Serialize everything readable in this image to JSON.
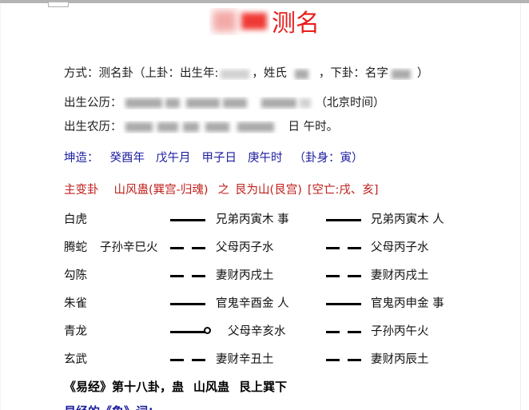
{
  "document": {
    "title_visible_text": "测名",
    "title_color": "#ea1c1c",
    "title_redacted_chars": 2
  },
  "info": {
    "method_label": "方式：",
    "method_value_a": "测名卦（上卦：出生年:",
    "method_value_b": "，姓氏",
    "method_value_c": "，下卦：名字",
    "method_value_d": "）",
    "solar_label": "出生公历：",
    "solar_suffix": "（北京时间）",
    "lunar_label": "出生农历：",
    "lunar_mid": "日",
    "lunar_suffix": "午时。"
  },
  "pillars": {
    "color": "#1c1ca0",
    "gender_label": "坤造：",
    "year": "癸酉年",
    "month": "戊午月",
    "day": "甲子日",
    "hour": "庚午时",
    "guashen": "（卦身：寅）"
  },
  "gua": {
    "color": "#c0201c",
    "label": "主变卦",
    "primary": "山风蛊(巽宫-归魂)",
    "connector": "之",
    "changed": "艮为山(艮宫)",
    "kongwang": "[空亡:戌、亥]"
  },
  "hexagram_rows": [
    {
      "beast": "白虎",
      "fushen": "",
      "yao_left": "solid",
      "yao_left_marker": false,
      "text_left": "兄弟丙寅木 事",
      "yao_right": "solid",
      "text_right": "兄弟丙寅木 人"
    },
    {
      "beast": "腾蛇",
      "fushen": "子孙辛巳火",
      "yao_left": "broken",
      "yao_left_marker": false,
      "text_left": "父母丙子水",
      "yao_right": "broken",
      "text_right": "父母丙子水"
    },
    {
      "beast": "勾陈",
      "fushen": "",
      "yao_left": "broken",
      "yao_left_marker": false,
      "text_left": "妻财丙戌土",
      "yao_right": "broken",
      "text_right": "妻财丙戌土"
    },
    {
      "beast": "朱雀",
      "fushen": "",
      "yao_left": "solid",
      "yao_left_marker": false,
      "text_left": "官鬼辛酉金 人",
      "yao_right": "solid",
      "text_right": "官鬼丙申金 事"
    },
    {
      "beast": "青龙",
      "fushen": "",
      "yao_left": "solid",
      "yao_left_marker": true,
      "text_left": "父母辛亥水",
      "yao_right": "broken",
      "text_right": "子孙丙午火"
    },
    {
      "beast": "玄武",
      "fushen": "",
      "yao_left": "broken",
      "yao_left_marker": false,
      "text_left": "妻财辛丑土",
      "yao_right": "broken",
      "text_right": "妻财丙辰土"
    }
  ],
  "footer": {
    "classic_line_a": "《易经》第十八卦，蛊",
    "classic_line_b": "山风蛊",
    "classic_line_c": "艮上巽下",
    "partial_blue_line": "易经的《象》词：",
    "partial_blue_color": "#1c1ca0"
  }
}
